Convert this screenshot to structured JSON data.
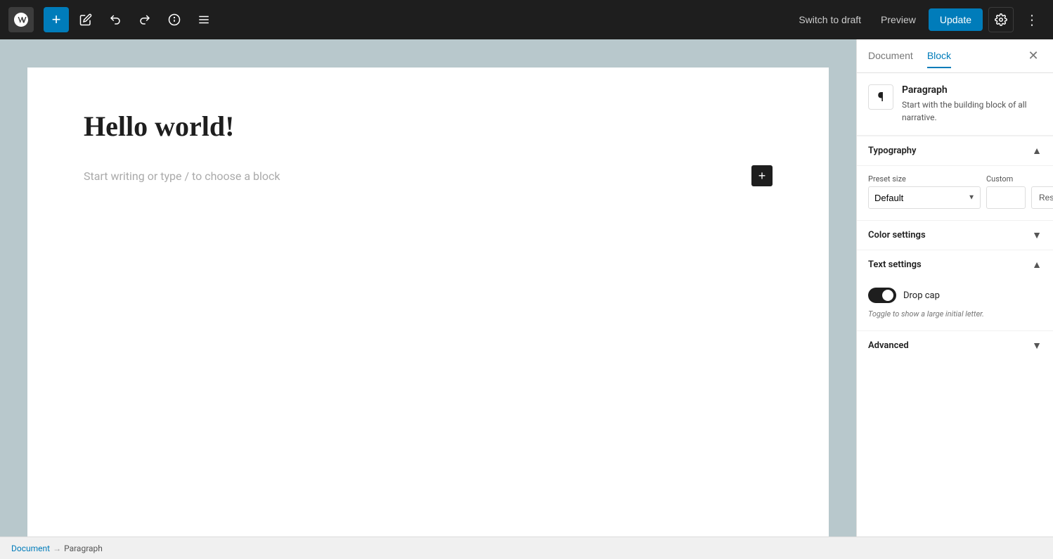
{
  "topbar": {
    "add_label": "+",
    "switch_draft_label": "Switch to draft",
    "preview_label": "Preview",
    "update_label": "Update"
  },
  "editor": {
    "title": "Hello world!",
    "placeholder": "Start writing or type / to choose a block"
  },
  "sidebar": {
    "tab_document": "Document",
    "tab_block": "Block",
    "block_name": "Paragraph",
    "block_description": "Start with the building block of all narrative.",
    "typography_label": "Typography",
    "preset_size_label": "Preset size",
    "custom_label": "Custom",
    "preset_default": "Default",
    "reset_label": "Reset",
    "color_settings_label": "Color settings",
    "text_settings_label": "Text settings",
    "drop_cap_label": "Drop cap",
    "drop_cap_hint": "Toggle to show a large initial letter.",
    "advanced_label": "Advanced"
  },
  "bottombar": {
    "document_label": "Document",
    "separator": "→",
    "paragraph_label": "Paragraph"
  }
}
